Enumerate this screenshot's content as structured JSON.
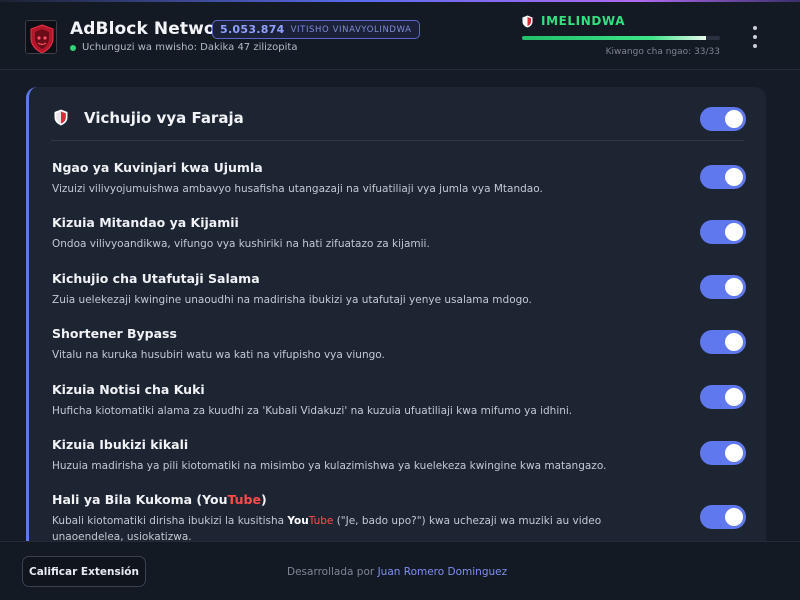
{
  "header": {
    "app_title": "AdBlock Network",
    "logo_text": "AdBlock",
    "blocked_count": "5.053.874",
    "blocked_label": "VITISHO VINAVYOLINDWA",
    "update_text": "Uchunguzi wa mwisho: Dakika 47 zilizopita",
    "status_label": "IMELINDWA",
    "protection_level": "Kiwango cha ngao: 33/33",
    "protection_fraction": 0.93
  },
  "card": {
    "title": "Vichujio vya Faraja",
    "master_toggle_on": true,
    "filters": [
      {
        "name": "Ngao ya Kuvinjari kwa Ujumla",
        "description": "Vizuizi vilivyojumuishwa ambavyo husafisha utangazaji na vifuatiliaji vya jumla vya Mtandao.",
        "enabled": true
      },
      {
        "name": "Kizuia Mitandao ya Kijamii",
        "description": "Ondoa vilivyoandikwa, vifungo vya kushiriki na hati zifuatazo za kijamii.",
        "enabled": true
      },
      {
        "name": "Kichujio cha Utafutaji Salama",
        "description": "Zuia uelekezaji kwingine unaoudhi na madirisha ibukizi ya utafutaji yenye usalama mdogo.",
        "enabled": true
      },
      {
        "name": "Shortener Bypass",
        "description": "Vitalu na kuruka husubiri watu wa kati na vifupisho vya viungo.",
        "enabled": true
      },
      {
        "name": "Kizuia Notisi cha Kuki",
        "description": "Huficha kiotomatiki alama za kuudhi za 'Kubali Vidakuzi' na kuzuia ufuatiliaji kwa mifumo ya idhini.",
        "enabled": true
      },
      {
        "name": "Kizuia Ibukizi kikali",
        "description": "Huzuia madirisha ya pili kiotomatiki na misimbo ya kulazimishwa ya kuelekeza kwingine kwa matangazo.",
        "enabled": true
      }
    ],
    "youtube_filter": {
      "name_prefix": "Hali ya Bila Kukoma (",
      "name_you": "You",
      "name_tube": "Tube",
      "name_suffix": ")",
      "desc_prefix": "Kubali kiotomatiki dirisha ibukizi la kusitisha ",
      "desc_you": "You",
      "desc_tube": "Tube",
      "desc_suffix": " (\"Je, bado upo?\") kwa uchezaji wa muziki au video unaoendelea, usiokatizwa.",
      "enabled": true
    }
  },
  "footer": {
    "rate_button": "Calificar Extensión",
    "credit_prefix": "Desarrollada por",
    "credit_author": "Juan Romero Dominguez"
  },
  "colors": {
    "accent": "#6078ee",
    "status_green": "#33e07f",
    "youtube_red": "#ff4b4b",
    "background": "#161c27",
    "card": "#1e2532"
  },
  "icons": {
    "logo": "adblock-logo",
    "status": "shield-icon",
    "card": "shield-icon",
    "menu": "kebab-menu-icon"
  }
}
